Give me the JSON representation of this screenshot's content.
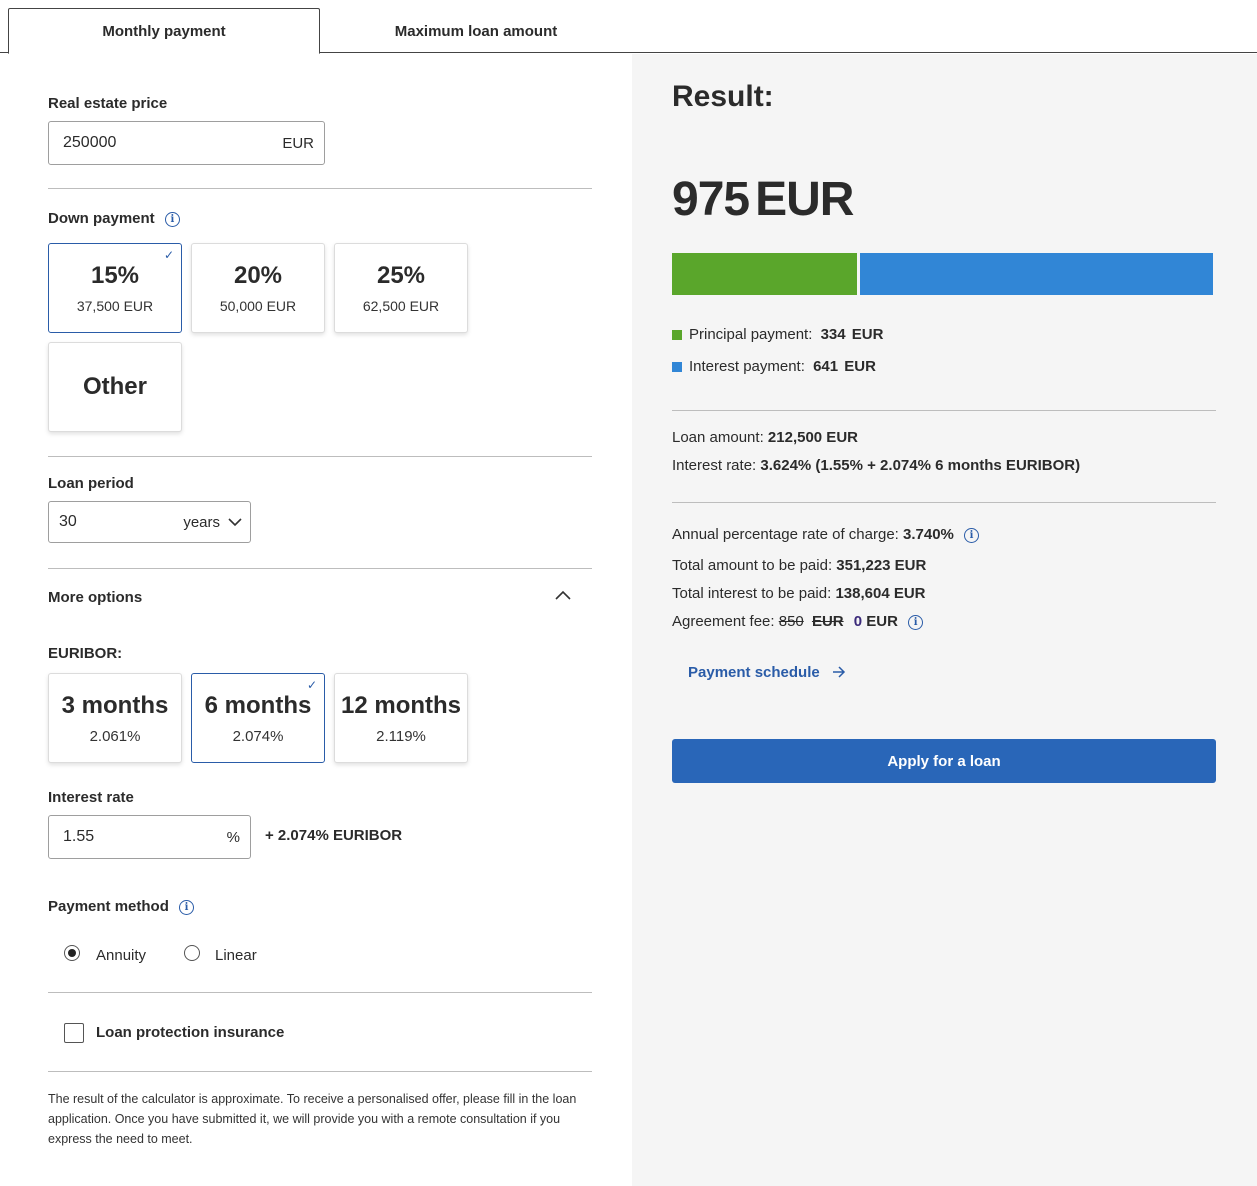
{
  "tabs": [
    {
      "label": "Monthly payment",
      "active": true
    },
    {
      "label": "Maximum loan amount",
      "active": false
    }
  ],
  "form": {
    "real_estate_price": {
      "label": "Real estate price",
      "value": "250000",
      "unit": "EUR"
    },
    "down_payment": {
      "label": "Down payment",
      "options": [
        {
          "percent": "15%",
          "amount": "37,500 EUR",
          "selected": true
        },
        {
          "percent": "20%",
          "amount": "50,000 EUR",
          "selected": false
        },
        {
          "percent": "25%",
          "amount": "62,500 EUR",
          "selected": false
        }
      ],
      "other_label": "Other"
    },
    "loan_period": {
      "label": "Loan period",
      "value": "30",
      "unit": "years"
    },
    "more_options": {
      "label": "More options"
    },
    "euribor": {
      "label": "EURIBOR:",
      "options": [
        {
          "label": "3 months",
          "rate": "2.061%",
          "selected": false
        },
        {
          "label": "6 months",
          "rate": "2.074%",
          "selected": true
        },
        {
          "label": "12 months",
          "rate": "2.119%",
          "selected": false
        }
      ]
    },
    "interest_rate": {
      "label": "Interest rate",
      "value": "1.55",
      "unit": "%",
      "suffix": "+ 2.074% EURIBOR"
    },
    "payment_method": {
      "label": "Payment method",
      "options": [
        {
          "label": "Annuity",
          "selected": true
        },
        {
          "label": "Linear",
          "selected": false
        }
      ]
    },
    "insurance": {
      "label": "Loan protection insurance",
      "checked": false
    },
    "disclaimer": "The result of the calculator is approximate. To receive a personalised offer, please fill in the loan application. Once you have submitted it, we will provide you with a remote consultation if you express the need to meet."
  },
  "result": {
    "title": "Result:",
    "amount": "975",
    "currency": "EUR",
    "breakdown": {
      "principal_fraction": 0.343,
      "principal_color": "#5aa62b",
      "interest_color": "#3186d6"
    },
    "principal": {
      "label": "Principal payment:",
      "value": "334",
      "unit": "EUR"
    },
    "interest": {
      "label": "Interest payment:",
      "value": "641",
      "unit": "EUR"
    },
    "loan_amount": {
      "label": "Loan amount:",
      "value": "212,500 EUR"
    },
    "interest_rate": {
      "label": "Interest rate:",
      "value": "3.624% (1.55% + 2.074% 6 months EURIBOR)"
    },
    "apr": {
      "label": "Annual percentage rate of charge:",
      "value": "3.740%"
    },
    "total_paid": {
      "label": "Total amount to be paid:",
      "value": "351,223 EUR"
    },
    "total_interest": {
      "label": "Total interest to be paid:",
      "value": "138,604 EUR"
    },
    "agreement_fee": {
      "label": "Agreement fee:",
      "old_value": "850",
      "old_unit": "EUR",
      "new_value": "0",
      "new_unit": "EUR"
    },
    "schedule_link": "Payment schedule",
    "apply_button": "Apply for a loan"
  }
}
